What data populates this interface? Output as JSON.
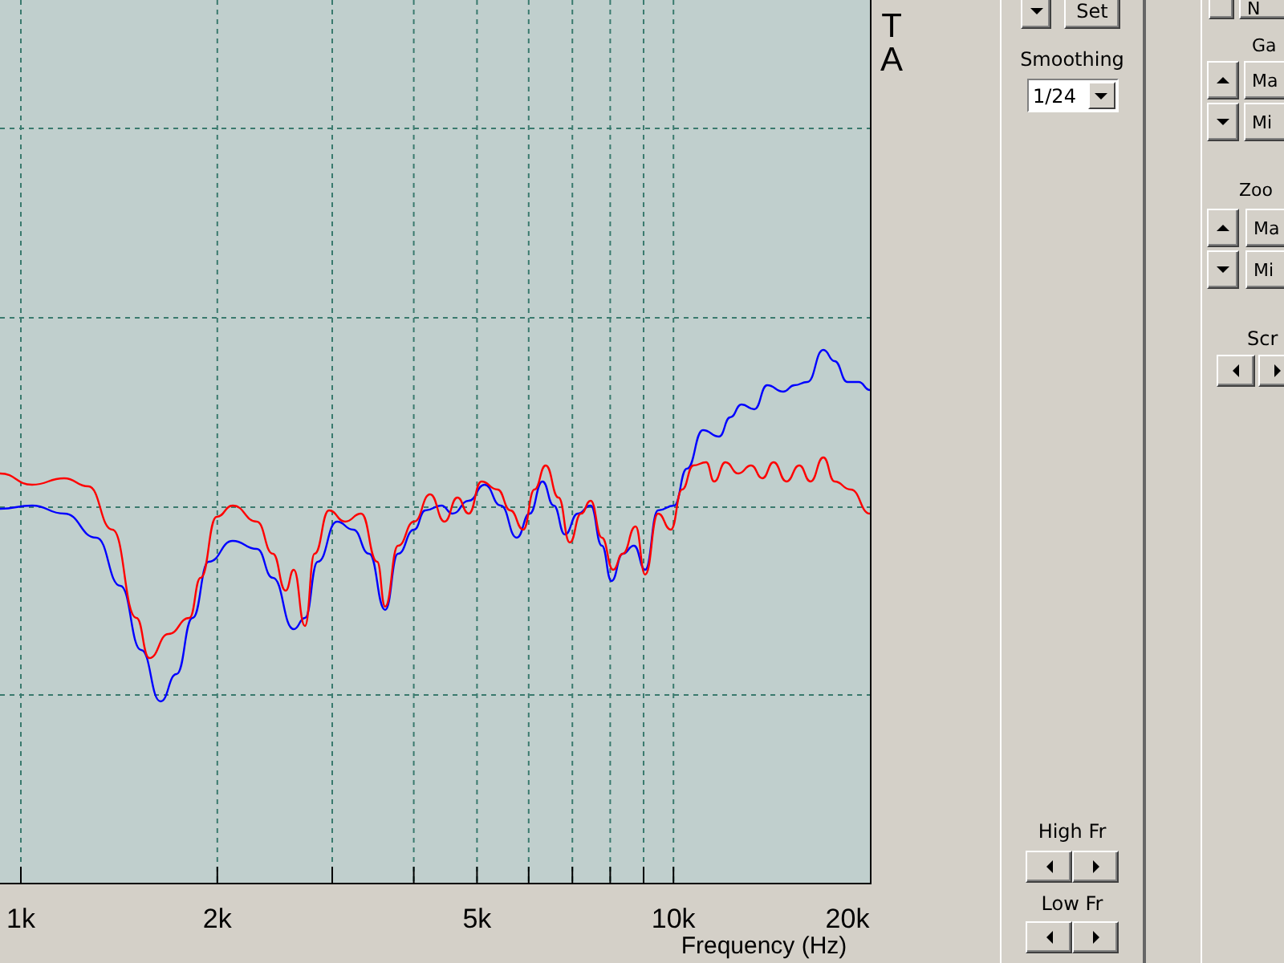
{
  "side_label": "TA",
  "plot": {
    "xtick_labels": [
      "1k",
      "2k",
      "5k",
      "10k",
      "20k"
    ],
    "xlabel": "Frequency (Hz)"
  },
  "smoothing_panel": {
    "set_button": "Set",
    "smoothing_label": "Smoothing",
    "smoothing_value": "1/24",
    "high_fr_label": "High Fr",
    "low_fr_label": "Low Fr"
  },
  "right_panel": {
    "top_button": "N",
    "gain_label": "Ga",
    "gain_buttons": [
      "Ma",
      "Mi"
    ],
    "zoom_label": "Zoo",
    "zoom_buttons": [
      "Ma",
      "Mi"
    ],
    "scroll_label": "Scr"
  }
}
